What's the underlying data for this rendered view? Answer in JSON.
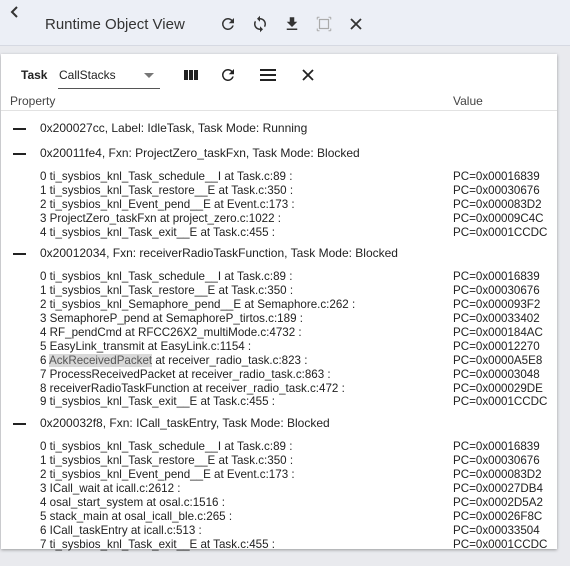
{
  "window": {
    "title": "Runtime Object View",
    "icons": [
      "back-icon",
      "refresh-icon",
      "sync-icon",
      "download-icon",
      "maximize-icon",
      "close-icon"
    ]
  },
  "panel": {
    "task_label": "Task",
    "task_value": "CallStacks",
    "columns": {
      "property": "Property",
      "value": "Value"
    },
    "icons": [
      "columns-icon",
      "refresh-icon",
      "menu-icon",
      "close-icon"
    ]
  },
  "groups": [
    {
      "label": "0x200027cc, Label: IdleTask, Task Mode: Running",
      "frames": []
    },
    {
      "label": "0x20011fe4, Fxn: ProjectZero_taskFxn, Task Mode: Blocked",
      "frames": [
        {
          "label": "0 ti_sysbios_knl_Task_schedule__I at Task.c:89 :",
          "value": "PC=0x00016839"
        },
        {
          "label": "1 ti_sysbios_knl_Task_restore__E at Task.c:350 :",
          "value": "PC=0x00030676"
        },
        {
          "label": "2 ti_sysbios_knl_Event_pend__E at Event.c:173 :",
          "value": "PC=0x000083D2"
        },
        {
          "label": "3 ProjectZero_taskFxn at project_zero.c:1022 :",
          "value": "PC=0x00009C4C"
        },
        {
          "label": "4 ti_sysbios_knl_Task_exit__E at Task.c:455 :",
          "value": "PC=0x0001CCDC"
        }
      ]
    },
    {
      "label": "0x20012034, Fxn: receiverRadioTaskFunction, Task Mode: Blocked",
      "frames": [
        {
          "label": "0 ti_sysbios_knl_Task_schedule__I at Task.c:89 :",
          "value": "PC=0x00016839"
        },
        {
          "label": "1 ti_sysbios_knl_Task_restore__E at Task.c:350 :",
          "value": "PC=0x00030676"
        },
        {
          "label": "2 ti_sysbios_knl_Semaphore_pend__E at Semaphore.c:262 :",
          "value": "PC=0x000093F2"
        },
        {
          "label": "3 SemaphoreP_pend at SemaphoreP_tirtos.c:189 :",
          "value": "PC=0x00033402"
        },
        {
          "label": "4 RF_pendCmd at RFCC26X2_multiMode.c:4732 :",
          "value": "PC=0x000184AC"
        },
        {
          "label": "5 EasyLink_transmit at EasyLink.c:1154 :",
          "value": "PC=0x00012270"
        },
        {
          "prefix": "6 ",
          "highlight": "AckReceivedPacket",
          "suffix": " at receiver_radio_task.c:823 :",
          "value": "PC=0x0000A5E8"
        },
        {
          "label": "7 ProcessReceivedPacket at receiver_radio_task.c:863 :",
          "value": "PC=0x00003048"
        },
        {
          "label": "8 receiverRadioTaskFunction at receiver_radio_task.c:472 :",
          "value": "PC=0x000029DE"
        },
        {
          "label": "9 ti_sysbios_knl_Task_exit__E at Task.c:455 :",
          "value": "PC=0x0001CCDC"
        }
      ]
    },
    {
      "label": "0x200032f8, Fxn: ICall_taskEntry, Task Mode: Blocked",
      "frames": [
        {
          "label": "0 ti_sysbios_knl_Task_schedule__I at Task.c:89 :",
          "value": "PC=0x00016839"
        },
        {
          "label": "1 ti_sysbios_knl_Task_restore__E at Task.c:350 :",
          "value": "PC=0x00030676"
        },
        {
          "label": "2 ti_sysbios_knl_Event_pend__E at Event.c:173 :",
          "value": "PC=0x000083D2"
        },
        {
          "label": "3 ICall_wait at icall.c:2612 :",
          "value": "PC=0x00027DB4"
        },
        {
          "label": "4 osal_start_system at osal.c:1516 :",
          "value": "PC=0x0002D5A2"
        },
        {
          "label": "5 stack_main at osal_icall_ble.c:265 :",
          "value": "PC=0x00026F8C"
        },
        {
          "label": "6 ICall_taskEntry at icall.c:513 :",
          "value": "PC=0x00033504"
        },
        {
          "label": "7 ti_sysbios_knl_Task_exit__E at Task.c:455 :",
          "value": "PC=0x0001CCDC"
        }
      ]
    }
  ]
}
